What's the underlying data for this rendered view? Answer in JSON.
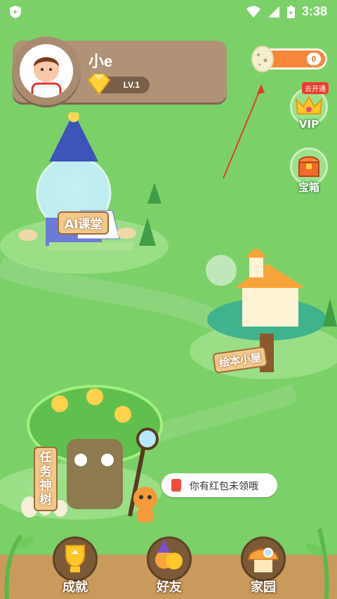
{
  "status_bar": {
    "time": "3:38"
  },
  "profile": {
    "name": "小e",
    "level": "LV.1"
  },
  "eggs": {
    "count": "0"
  },
  "side_buttons": {
    "vip": {
      "label": "VIP",
      "badge": "去开通"
    },
    "treasure": {
      "label": "宝箱"
    }
  },
  "map": {
    "ai_class": "AI课堂",
    "picture_book": "绘本小屋",
    "task_tree": "任务神树"
  },
  "notice": {
    "text": "你有红包未领哦"
  },
  "bottom_nav": [
    {
      "label": "成就"
    },
    {
      "label": "好友"
    },
    {
      "label": "家园"
    }
  ],
  "colors": {
    "grass": "#7cd068",
    "accent": "#f5863a",
    "wood": "#b09276"
  }
}
